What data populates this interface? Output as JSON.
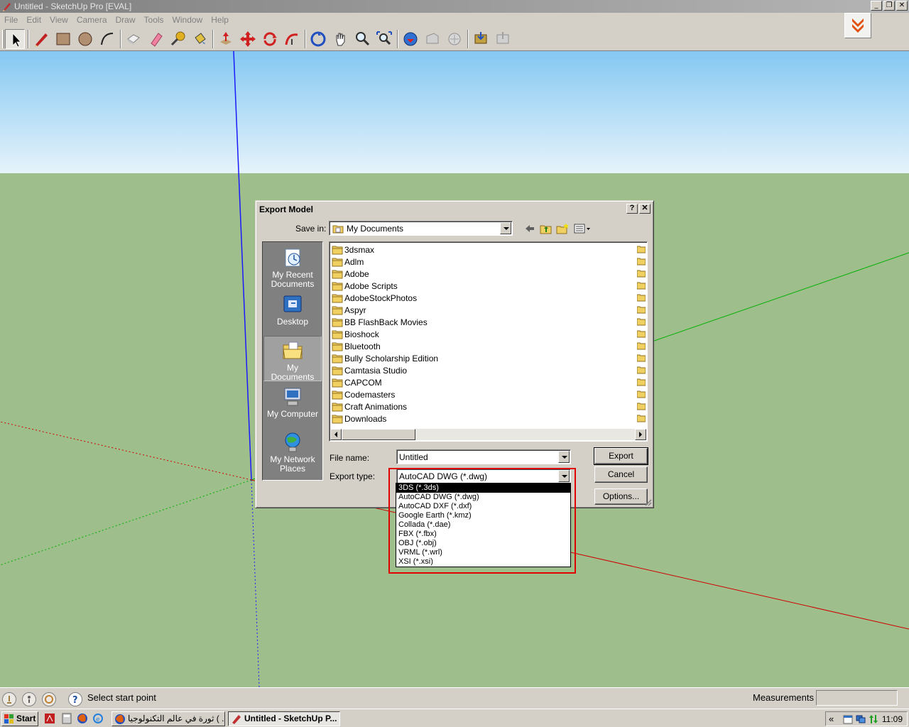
{
  "window": {
    "title": "Untitled - SketchUp Pro [EVAL]",
    "controls": [
      "_",
      "❐",
      "✕"
    ]
  },
  "menu": [
    "File",
    "Edit",
    "View",
    "Camera",
    "Draw",
    "Tools",
    "Window",
    "Help"
  ],
  "toolbar": {
    "tools": [
      "select-icon",
      "pencil-icon",
      "rectangle-icon",
      "circle-icon",
      "arc-icon",
      "eraser-icon",
      "paint-bucket-icon",
      "push-pull-icon",
      "move-icon",
      "rotate-icon",
      "offset-icon",
      "orbit-icon",
      "pan-icon",
      "zoom-icon",
      "zoom-extents-icon",
      "get-models-icon",
      "share-model-icon",
      "share-component-icon",
      "google-earth-icon"
    ]
  },
  "dialog": {
    "title": "Export Model",
    "help_btn": "?",
    "close_btn": "✕",
    "save_in_label": "Save in:",
    "save_in_value": "My Documents",
    "places": [
      "My Recent Documents",
      "Desktop",
      "My Documents",
      "My Computer",
      "My Network Places"
    ],
    "folders": [
      "3dsmax",
      "Adlm",
      "Adobe",
      "Adobe Scripts",
      "AdobeStockPhotos",
      "Aspyr",
      "BB FlashBack Movies",
      "Bioshock",
      "Bluetooth",
      "Bully Scholarship Edition",
      "Camtasia Studio",
      "CAPCOM",
      "Codemasters",
      "Craft Animations",
      "Downloads"
    ],
    "file_name_label": "File name:",
    "file_name_value": "Untitled",
    "export_type_label": "Export type:",
    "export_type_value": "AutoCAD DWG (*.dwg)",
    "export_btn": "Export",
    "cancel_btn": "Cancel",
    "options_btn": "Options..."
  },
  "export_type_options": [
    "3DS (*.3ds)",
    "AutoCAD DWG (*.dwg)",
    "AutoCAD DXF (*.dxf)",
    "Google Earth (*.kmz)",
    "Collada (*.dae)",
    "FBX (*.fbx)",
    "OBJ (*.obj)",
    "VRML (*.wrl)",
    "XSI (*.xsi)"
  ],
  "status": {
    "hint": "Select start point",
    "measurements_label": "Measurements",
    "measurements_value": ""
  },
  "taskbar": {
    "start": "Start",
    "tasks": [
      "ثورة في عالم التكنولوجيا ( ...",
      "Untitled - SketchUp P..."
    ],
    "tray_arrow": "«",
    "clock": "11:09"
  },
  "colors": {
    "sky_top": "#85c8f2",
    "ground": "#9ebe8c",
    "axis_blue": "#1a1aff",
    "axis_green": "#00b000",
    "axis_red": "#d00000",
    "highlight": "#e00000"
  }
}
